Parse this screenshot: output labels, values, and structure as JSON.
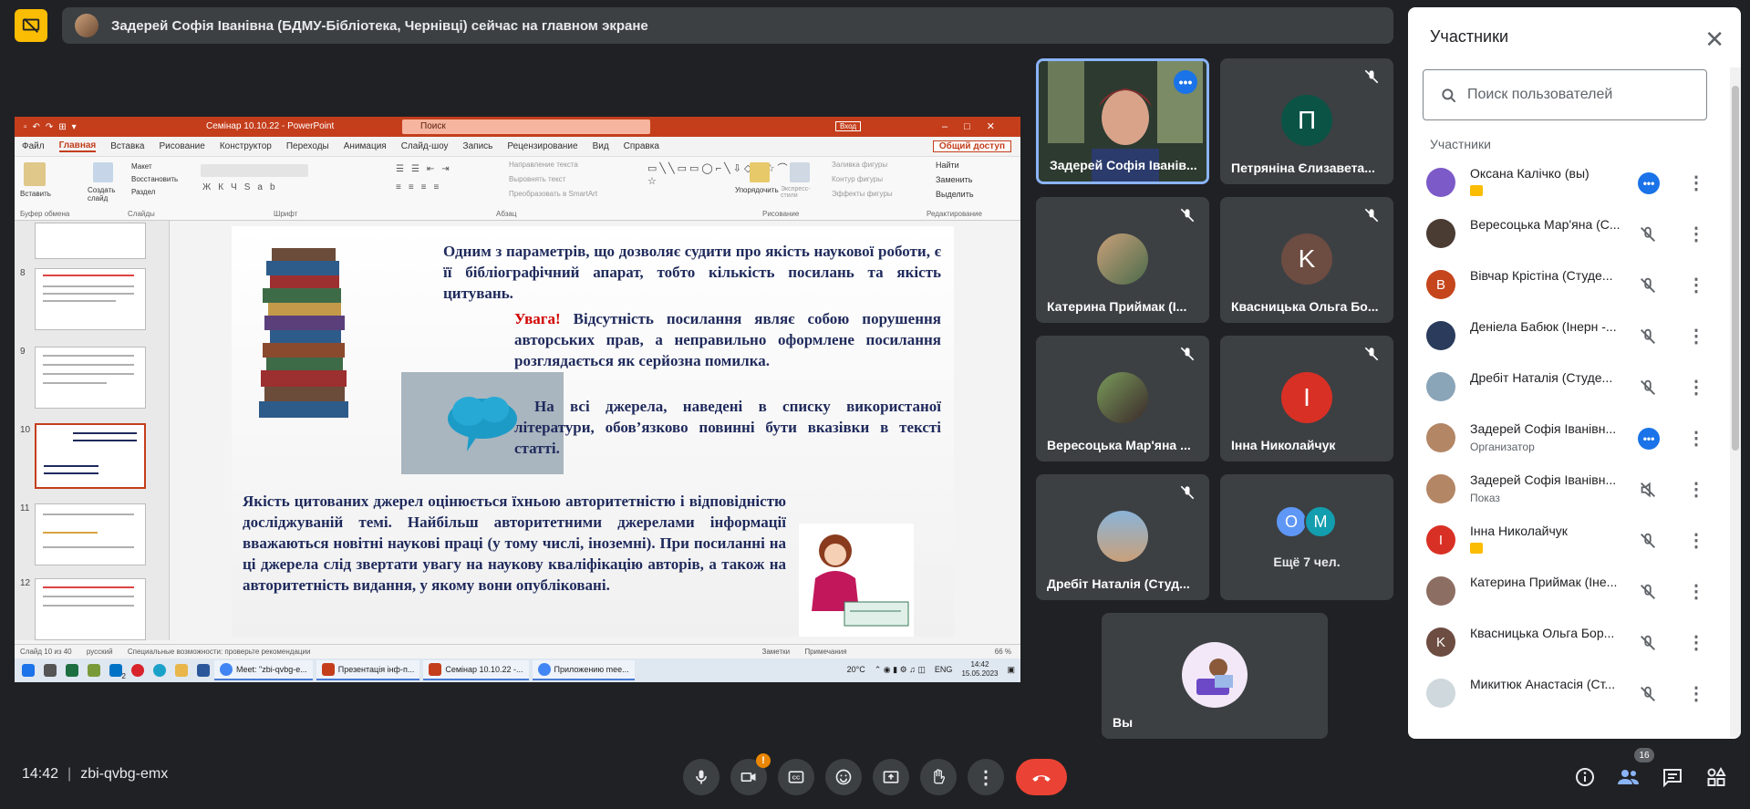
{
  "presenting": {
    "text": "Задерей Софія Іванівна (БДМУ-Бібліотека, Чернівці) сейчас на главном экране"
  },
  "powerpoint": {
    "file_name": "Семінар 10.10.22 - PowerPoint",
    "search_placeholder": "Поиск",
    "login": "Вход",
    "menu": [
      "Файл",
      "Главная",
      "Вставка",
      "Рисование",
      "Конструктор",
      "Переходы",
      "Анимация",
      "Слайд-шоу",
      "Запись",
      "Рецензирование",
      "Вид",
      "Справка"
    ],
    "share": "Общий доступ",
    "ribbon": {
      "paste": "Вставить",
      "create_slide": "Создать слайд",
      "layout": "Макет",
      "restore": "Восстановить",
      "section": "Раздел",
      "clipboard": "Буфер обмена",
      "slides": "Слайды",
      "font": "Шрифт",
      "paragraph": "Абзац",
      "text_direction": "Направление текста",
      "align_text": "Выровнять текст",
      "smartart": "Преобразовать в SmartArt",
      "arrange": "Упорядочить",
      "quick_styles": "Экспресс-стили",
      "shape_fill": "Заливка фигуры",
      "shape_outline": "Контур фигуры",
      "shape_effects": "Эффекты фигуры",
      "drawing": "Рисование",
      "find": "Найти",
      "replace": "Заменить",
      "select": "Выделить",
      "editing": "Редактирование"
    },
    "thumbnails": [
      "8",
      "9",
      "10",
      "11",
      "12"
    ],
    "slide": {
      "p1": "Одним з параметрів, що дозволяє судити про якість наукової роботи, є її бібліографічний апарат, тобто кількість посилань та якість цитувань.",
      "warn": "Увага!",
      "p2": " Відсутність посилання являє собою порушення авторських прав, а неправильно оформлене посилання розглядається як серйозна помилка.",
      "p3": "На всі джерела, наведені в списку використаної літератури, обов’язково повинні бути вказівки в тексті статті.",
      "p4": "Якість цитованих джерел оцінюється їхньою авторитетністю і відповідністю досліджуваній темі. Найбільш авторитетними джерелами інформації вважаються новітні наукові праці (у тому числі, іноземні). При посиланні на ці джерела слід звертати увагу на наукову кваліфікацію авторів, а також на авторитетність видання, у якому вони опубліковані."
    },
    "status": {
      "slide_info": "Слайд 10 из 40",
      "language": "русский",
      "accessibility": "Специальные возможности: проверьте рекомендации",
      "notes": "Заметки",
      "comments": "Примечания",
      "zoom": "66 %"
    },
    "taskbar": {
      "items": [
        "Meet: \"zbi-qvbg-e...",
        "Презентація інф-п...",
        "Семінар 10.10.22 -...",
        "Приложению mee..."
      ],
      "temp": "20°C",
      "lang": "ENG",
      "time": "14:42",
      "date": "15.05.2023",
      "mail_badge": "2"
    }
  },
  "tiles": [
    {
      "name": "Задерей Софія Іванів..."
    },
    {
      "name": "Петряніна Єлизавета...",
      "initial": "П",
      "color": "#0b5345"
    },
    {
      "name": "Катерина Приймак (І..."
    },
    {
      "name": "Квасницька Ольга Бо...",
      "initial": "K",
      "color": "#6d4c41"
    },
    {
      "name": "Вересоцька Мар'яна ..."
    },
    {
      "name": "Інна Николайчук",
      "initial": "I",
      "color": "#d93025"
    },
    {
      "name": "Дребіт Наталія (Студ..."
    },
    {
      "name": "Ещё 7 чел.",
      "initial1": "O",
      "initial2": "M"
    },
    {
      "name": "Вы"
    }
  ],
  "panel": {
    "title": "Участники",
    "search_placeholder": "Поиск пользователей",
    "section": "Участники",
    "people": [
      {
        "name": "Оксана Калічко (вы)",
        "sub": "",
        "initial": "",
        "color": "#7c5ac7"
      },
      {
        "name": "Вересоцька Мар'яна (С...",
        "sub": "",
        "initial": "",
        "color": "#4a3b33"
      },
      {
        "name": "Вівчар Крістіна (Студе...",
        "sub": "",
        "initial": "B",
        "color": "#c5451c"
      },
      {
        "name": "Деніела Бабюк (Інерн -...",
        "sub": "",
        "initial": "",
        "color": "#2a3b5c"
      },
      {
        "name": "Дребіт Наталія (Студе...",
        "sub": "",
        "initial": "",
        "color": "#8aa4b8"
      },
      {
        "name": "Задерей Софія Іванівн...",
        "sub": "Организатор",
        "initial": "",
        "color": "#b38665"
      },
      {
        "name": "Задерей Софія Іванівн...",
        "sub": "Показ",
        "initial": "",
        "color": "#b38665"
      },
      {
        "name": "Інна Николайчук",
        "sub": "",
        "initial": "I",
        "color": "#d93025"
      },
      {
        "name": "Катерина Приймак (Іне...",
        "sub": "",
        "initial": "",
        "color": "#8d6e63"
      },
      {
        "name": "Квасницька Ольга Бор...",
        "sub": "",
        "initial": "K",
        "color": "#6d4c41"
      },
      {
        "name": "Микитюк Анастасія (Ст...",
        "sub": "",
        "initial": "",
        "color": "#cfd8dc"
      }
    ]
  },
  "footer": {
    "time": "14:42",
    "meeting_code": "zbi-qvbg-emx",
    "alert_badge": "!",
    "participants_count": "16"
  }
}
